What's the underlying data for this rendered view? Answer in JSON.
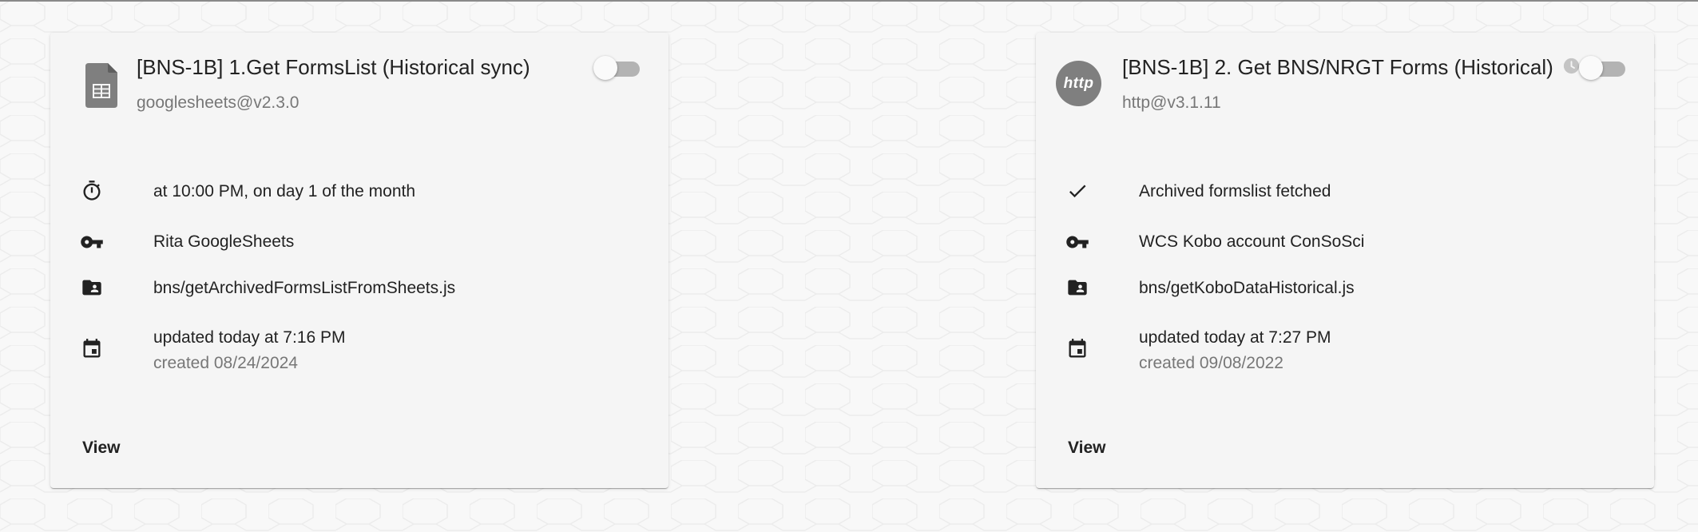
{
  "cards": [
    {
      "avatar": {
        "type": "sheets-icon",
        "text": ""
      },
      "title": "[BNS-1B] 1.Get FormsList (Historical sync)",
      "subtitle": "googlesheets@v2.3.0",
      "has_clock": false,
      "enabled": false,
      "rows": {
        "trigger": {
          "icon": "timer-icon",
          "text": "at 10:00 PM, on day 1 of the month"
        },
        "credential": {
          "icon": "key-icon",
          "text": "Rita GoogleSheets"
        },
        "source": {
          "icon": "folder-account-icon",
          "text": "bns/getArchivedFormsListFromSheets.js"
        },
        "dates": {
          "icon": "calendar-icon",
          "updated": "updated today at 7:16 PM",
          "created": "created 08/24/2024"
        }
      },
      "view_label": "View"
    },
    {
      "avatar": {
        "type": "http-icon",
        "text": "http"
      },
      "title": "[BNS-1B] 2. Get BNS/NRGT Forms (Historical)",
      "subtitle": "http@v3.1.11",
      "has_clock": true,
      "enabled": false,
      "rows": {
        "trigger": {
          "icon": "check-icon",
          "text": "Archived formslist fetched"
        },
        "credential": {
          "icon": "key-icon",
          "text": "WCS Kobo account ConSoSci"
        },
        "source": {
          "icon": "folder-account-icon",
          "text": "bns/getKoboDataHistorical.js"
        },
        "dates": {
          "icon": "calendar-icon",
          "updated": "updated today at 7:27 PM",
          "created": "created 09/08/2022"
        }
      },
      "view_label": "View"
    }
  ],
  "colors": {
    "background": "#f8f8f8",
    "card": "#f5f5f5",
    "icon": "#222222",
    "muted_text": "#777777",
    "avatar_grey": "#7f7f7f",
    "toggle_track": "#b3b3b3"
  }
}
